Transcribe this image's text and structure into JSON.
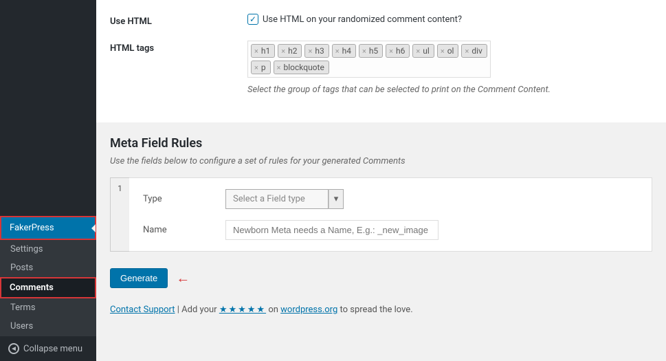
{
  "sidebar": {
    "parent": "FakerPress",
    "items": [
      "Settings",
      "Posts",
      "Comments",
      "Terms",
      "Users"
    ],
    "collapse": "Collapse menu"
  },
  "useHtml": {
    "label": "Use HTML",
    "text": "Use HTML on your randomized comment content?"
  },
  "htmlTags": {
    "label": "HTML tags",
    "tags": [
      "h1",
      "h2",
      "h3",
      "h4",
      "h5",
      "h6",
      "ul",
      "ol",
      "div",
      "p",
      "blockquote"
    ],
    "help": "Select the group of tags that can be selected to print on the Comment Content."
  },
  "meta": {
    "heading": "Meta Field Rules",
    "desc": "Use the fields below to configure a set of rules for your generated Comments",
    "index": "1",
    "typeLabel": "Type",
    "typePlaceholder": "Select a Field type",
    "nameLabel": "Name",
    "namePlaceholder": "Newborn Meta needs a Name, E.g.: _new_image"
  },
  "generate": "Generate",
  "footer": {
    "support": "Contact Support",
    "mid1": " | Add your ",
    "stars": "★★★★★",
    "mid2": " on ",
    "wp": "wordpress.org",
    "end": " to spread the love."
  }
}
